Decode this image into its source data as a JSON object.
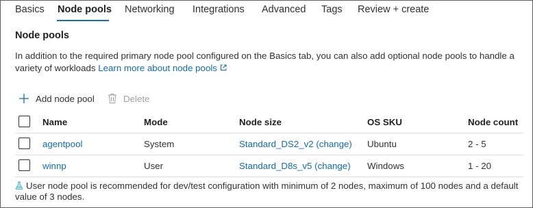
{
  "tabs": [
    {
      "label": "Basics",
      "active": false
    },
    {
      "label": "Node pools",
      "active": true
    },
    {
      "label": "Networking",
      "active": false
    },
    {
      "label": "Integrations",
      "active": false
    },
    {
      "label": "Advanced",
      "active": false
    },
    {
      "label": "Tags",
      "active": false
    },
    {
      "label": "Review + create",
      "active": false
    }
  ],
  "section": {
    "title": "Node pools",
    "description": "In addition to the required primary node pool configured on the Basics tab, you can also add optional node pools to handle a variety of workloads",
    "learn_more_link": "Learn more about node pools"
  },
  "toolbar": {
    "add_label": "Add node pool",
    "delete_label": "Delete"
  },
  "table": {
    "columns": [
      "Name",
      "Mode",
      "Node size",
      "OS SKU",
      "Node count"
    ],
    "rows": [
      {
        "name": "agentpool",
        "mode": "System",
        "node_size": "Standard_DS2_v2 (change)",
        "os_sku": "Ubuntu",
        "node_count": "2 - 5",
        "checked": false
      },
      {
        "name": "winnp",
        "mode": "User",
        "node_size": "Standard_D8s_v5 (change)",
        "os_sku": "Windows",
        "node_count": "1 - 20",
        "checked": false
      }
    ]
  },
  "note": {
    "icon": "flask-icon",
    "text": "User node pool is recommended for dev/test configuration with minimum of 2 nodes, maximum of 100 nodes and a default value of 3 nodes."
  },
  "colors": {
    "accent": "#0f6cbd",
    "text": "#323130",
    "disabled": "#a19f9d",
    "divider": "#e1dfdd",
    "note_icon": "#4fb3c8"
  }
}
